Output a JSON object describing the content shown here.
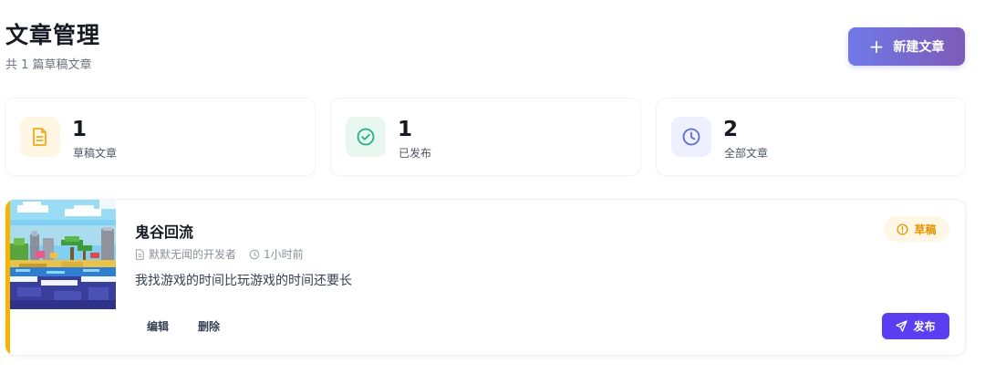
{
  "header": {
    "title": "文章管理",
    "subtitle": "共 1 篇草稿文章",
    "new_button_label": "新建文章"
  },
  "stats": [
    {
      "value": "1",
      "label": "草稿文章",
      "icon": "document-icon",
      "color": "#f0a91c"
    },
    {
      "value": "1",
      "label": "已发布",
      "icon": "check-circle-icon",
      "color": "#22b07d"
    },
    {
      "value": "2",
      "label": "全部文章",
      "icon": "clock-icon",
      "color": "#5b6be0"
    }
  ],
  "article": {
    "title": "鬼谷回流",
    "author": "默默无闻的开发者",
    "time": "1小时前",
    "excerpt": "我找游戏的时间比玩游戏的时间还要长",
    "status": "草稿",
    "edit_label": "编辑",
    "delete_label": "删除",
    "publish_label": "发布",
    "thumbnail": "pixel-art-game-scene"
  },
  "colors": {
    "accent": "#5b3ef0",
    "draft": "#f4b400"
  }
}
